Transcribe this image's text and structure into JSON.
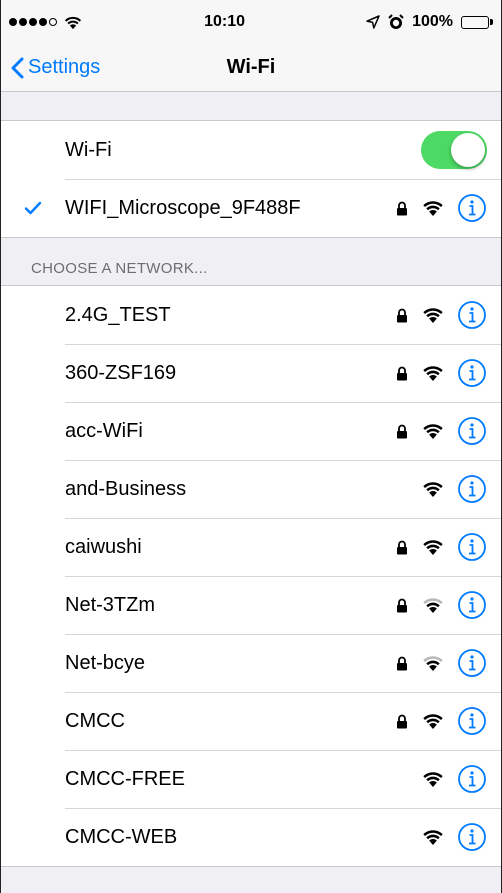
{
  "status_bar": {
    "time": "10:10",
    "battery": "100%",
    "signal_bars_filled": 4,
    "signal_bars_total": 5
  },
  "nav": {
    "back_label": "Settings",
    "title": "Wi-Fi"
  },
  "wifi_toggle": {
    "label": "Wi-Fi",
    "on": true
  },
  "connected": {
    "name": "WIFI_Microscope_9F488F",
    "locked": true,
    "signal": "full"
  },
  "section_header": "CHOOSE A NETWORK...",
  "networks": [
    {
      "name": "2.4G_TEST",
      "locked": true,
      "signal": "full"
    },
    {
      "name": "360-ZSF169",
      "locked": true,
      "signal": "full"
    },
    {
      "name": "acc-WiFi",
      "locked": true,
      "signal": "full"
    },
    {
      "name": "and-Business",
      "locked": false,
      "signal": "full"
    },
    {
      "name": "caiwushi",
      "locked": true,
      "signal": "full"
    },
    {
      "name": "Net-3TZm",
      "locked": true,
      "signal": "weak"
    },
    {
      "name": "Net-bcye",
      "locked": true,
      "signal": "weak"
    },
    {
      "name": "CMCC",
      "locked": true,
      "signal": "full"
    },
    {
      "name": "CMCC-FREE",
      "locked": false,
      "signal": "full"
    },
    {
      "name": "CMCC-WEB",
      "locked": false,
      "signal": "full"
    }
  ],
  "colors": {
    "accent": "#007aff",
    "toggle_on": "#4cd964"
  },
  "icons": {
    "lock": "lock-icon",
    "wifi": "wifi-signal-icon",
    "info": "info-icon",
    "check": "checkmark-icon",
    "back": "chevron-left-icon"
  }
}
